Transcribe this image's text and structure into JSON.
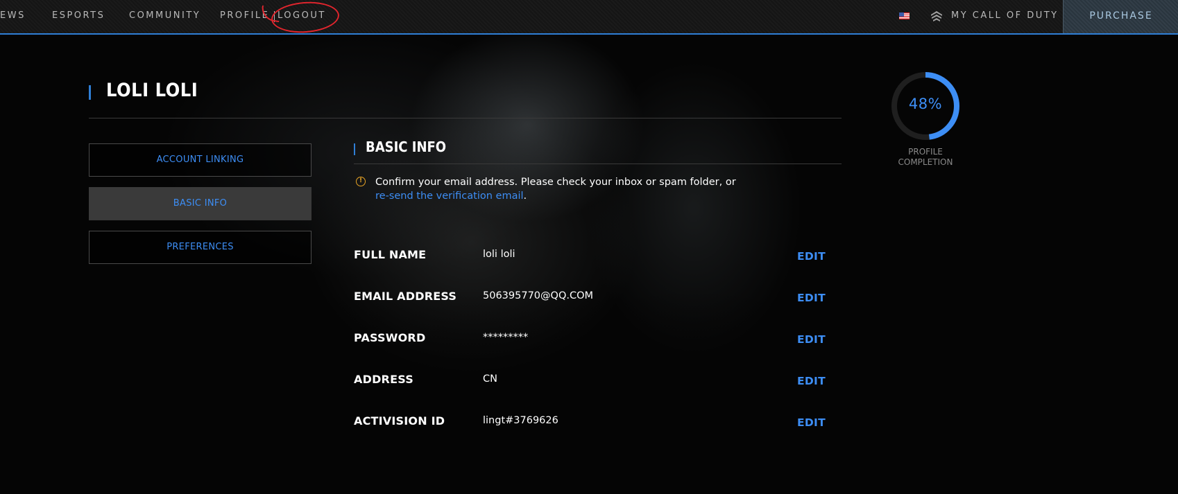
{
  "nav": {
    "items": [
      "EWS",
      "ESPORTS",
      "COMMUNITY",
      "PROFILE",
      "LOGOUT"
    ],
    "my_cod": "MY CALL OF DUTY",
    "purchase": "PURCHASE",
    "flag_icon": "us-flag-icon",
    "cod_icon": "call-of-duty-emblem-icon",
    "accent": "#2f7fd6",
    "annotation_color": "#e0252d"
  },
  "profile": {
    "name": "LOLI LOLI",
    "completion_percent": 48,
    "completion_label": "48%",
    "completion_caption_1": "PROFILE",
    "completion_caption_2": "COMPLETION"
  },
  "sidebar": {
    "items": [
      {
        "label": "ACCOUNT LINKING",
        "active": false
      },
      {
        "label": "BASIC INFO",
        "active": true
      },
      {
        "label": "PREFERENCES",
        "active": false
      }
    ]
  },
  "basic_info": {
    "title": "BASIC INFO",
    "notice_text": "Confirm your email address. Please check your inbox or spam folder, or",
    "notice_link": "re-send the verification email",
    "notice_end": ".",
    "fields": [
      {
        "label": "FULL NAME",
        "value": "loli loli",
        "edit": "EDIT"
      },
      {
        "label": "EMAIL ADDRESS",
        "value": "506395770@QQ.COM",
        "edit": "EDIT"
      },
      {
        "label": "PASSWORD",
        "value": "*********",
        "edit": "EDIT"
      },
      {
        "label": "ADDRESS",
        "value": "CN",
        "edit": "EDIT"
      },
      {
        "label": "ACTIVISION ID",
        "value": "lingt#3769626",
        "edit": "EDIT"
      }
    ]
  },
  "colors": {
    "link": "#3d8ef5",
    "warning": "#e9a525"
  }
}
